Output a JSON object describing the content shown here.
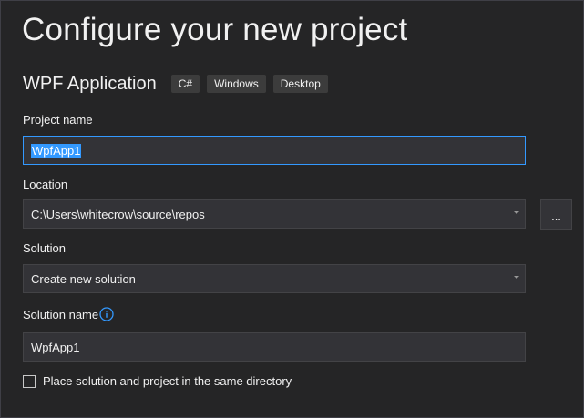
{
  "dialog": {
    "title": "Configure your new project",
    "template": {
      "name": "WPF Application",
      "tags": [
        "C#",
        "Windows",
        "Desktop"
      ]
    }
  },
  "form": {
    "project_name": {
      "label": "Project name",
      "value": "WpfApp1"
    },
    "location": {
      "label": "Location",
      "value": "C:\\Users\\whitecrow\\source\\repos",
      "browse_label": "..."
    },
    "solution": {
      "label": "Solution",
      "value": "Create new solution"
    },
    "solution_name": {
      "label": "Solution name",
      "value": "WpfApp1",
      "info_icon": "info-icon"
    },
    "same_directory": {
      "label": "Place solution and project in the same directory",
      "checked": false
    }
  },
  "colors": {
    "background": "#252526",
    "field_background": "#333337",
    "field_border": "#434346",
    "focus_border": "#3399ff",
    "selection": "#3399ff",
    "text": "#f1f1f1",
    "info_icon": "#3399ff"
  }
}
